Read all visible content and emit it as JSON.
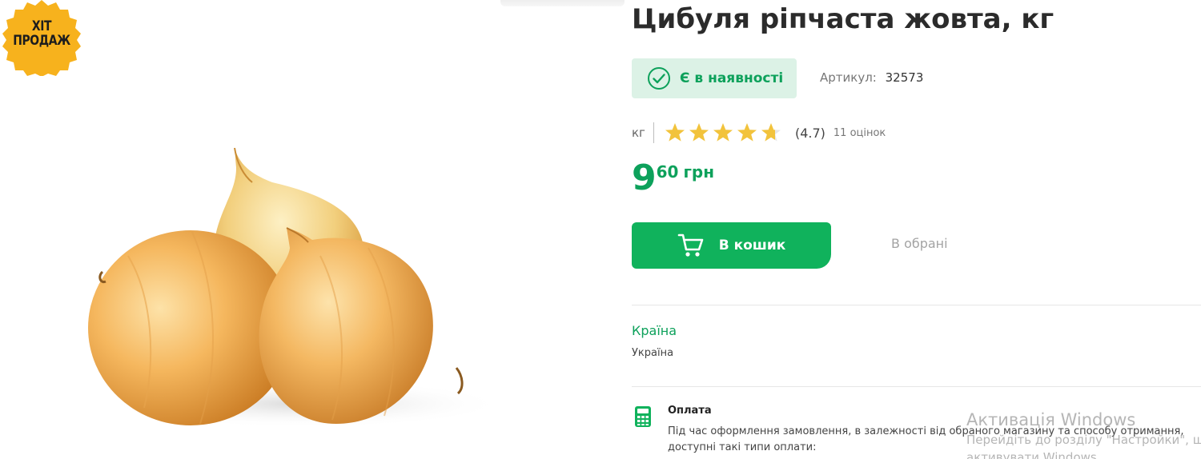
{
  "badge": {
    "line1": "ХІТ",
    "line2": "ПРОДАЖ",
    "color": "#f7b21d"
  },
  "product": {
    "title": "Цибуля ріпчаста жовта, кг",
    "image_icon": "onion-image",
    "stock_status": "Є в наявності",
    "sku_label": "Артикул:",
    "sku_value": "32573",
    "unit": "кг",
    "rating": {
      "value": 4.7,
      "max": 5,
      "label": "(4.7)",
      "count_label": "11 оцінок"
    },
    "price": {
      "integer": "9",
      "fraction": "60",
      "currency": "грн"
    },
    "cart_button_label": "В кошик",
    "favorites_label": "В обрані"
  },
  "attributes": {
    "country_label": "Країна",
    "country_value": "Україна"
  },
  "payment": {
    "title": "Оплата",
    "text": "Під час оформлення замовлення, в залежності від обраного магазину та способу отримання, доступні такі типи оплати:"
  },
  "watermark": {
    "line1": "Активація Windows",
    "line2": "Перейдіть до розділу \"Настройки\", щоб",
    "line3": "активувати Windows."
  },
  "colors": {
    "accent_green": "#10b25c",
    "stock_bg": "#dcf2e6",
    "star_yellow": "#f2c33c",
    "badge_yellow": "#f7b21d"
  }
}
